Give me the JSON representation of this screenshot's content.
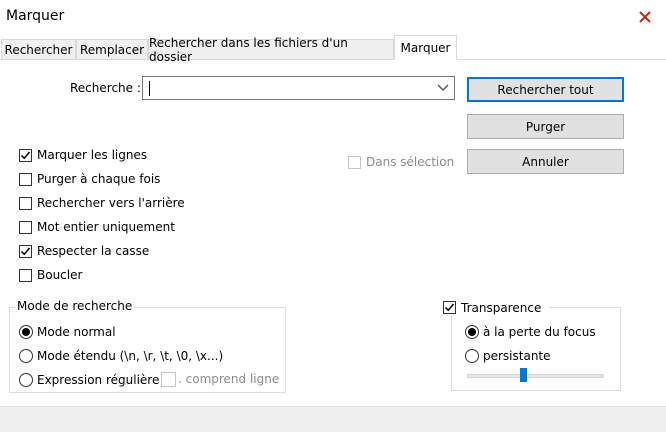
{
  "window": {
    "title": "Marquer"
  },
  "tabs": [
    {
      "label": "Rechercher"
    },
    {
      "label": "Remplacer"
    },
    {
      "label": "Rechercher dans les fichiers d'un dossier"
    },
    {
      "label": "Marquer",
      "active": true
    }
  ],
  "search": {
    "label": "Recherche :",
    "value": ""
  },
  "buttons": {
    "find_all": "Rechercher tout",
    "clear": "Purger",
    "cancel": "Annuler"
  },
  "options": [
    {
      "label": "Marquer les lignes",
      "checked": true
    },
    {
      "label": "Purger à chaque fois",
      "checked": false
    },
    {
      "label": "Rechercher vers l'arrière",
      "checked": false
    },
    {
      "label": "Mot entier uniquement",
      "checked": false
    },
    {
      "label": "Respecter la casse",
      "checked": true
    },
    {
      "label": "Boucler",
      "checked": false
    }
  ],
  "in_selection": {
    "label": "Dans sélection",
    "checked": false,
    "enabled": false
  },
  "search_mode": {
    "title": "Mode de recherche",
    "options": [
      {
        "label": "Mode normal",
        "selected": true
      },
      {
        "label": "Mode étendu (\\n, \\r, \\t, \\0, \\x...)",
        "selected": false
      },
      {
        "label": "Expression régulière",
        "selected": false
      }
    ],
    "dot_matches_newline": {
      "label": ". comprend ligne",
      "checked": false,
      "enabled": false
    }
  },
  "transparency": {
    "title": "Transparence",
    "checked": true,
    "options": [
      {
        "label": "à la perte du focus",
        "selected": true
      },
      {
        "label": "persistante",
        "selected": false
      }
    ],
    "level": 0.4
  },
  "colors": {
    "accent": "#0078d7",
    "button_bg": "#e1e1e1",
    "tab_bg": "#f0f0f0"
  }
}
